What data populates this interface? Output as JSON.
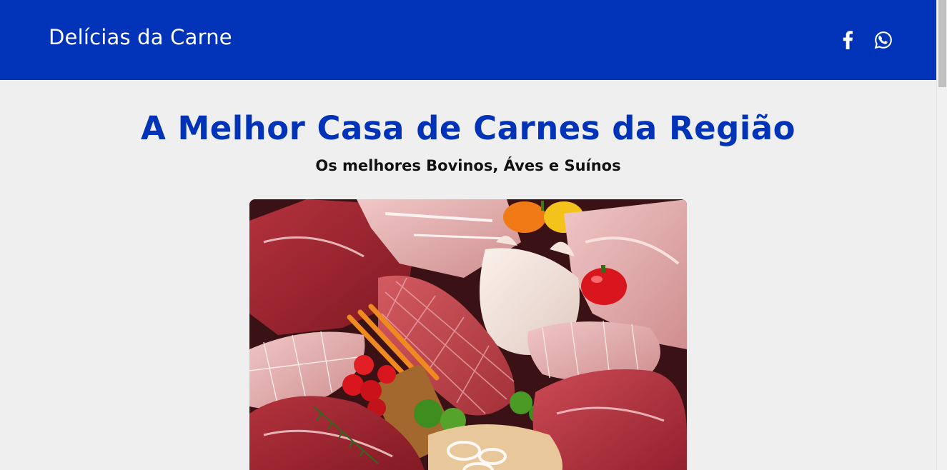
{
  "header": {
    "brand": "Delícias da Carne",
    "background_color": "#0033b8",
    "social_icons": [
      "facebook-icon",
      "whatsapp-icon"
    ]
  },
  "main": {
    "headline": "A Melhor Casa de Carnes da Região",
    "subheadline": "Os melhores Bovinos, Áves e Suínos",
    "headline_color": "#0033b8",
    "hero_image": "meat-assortment-photo"
  }
}
